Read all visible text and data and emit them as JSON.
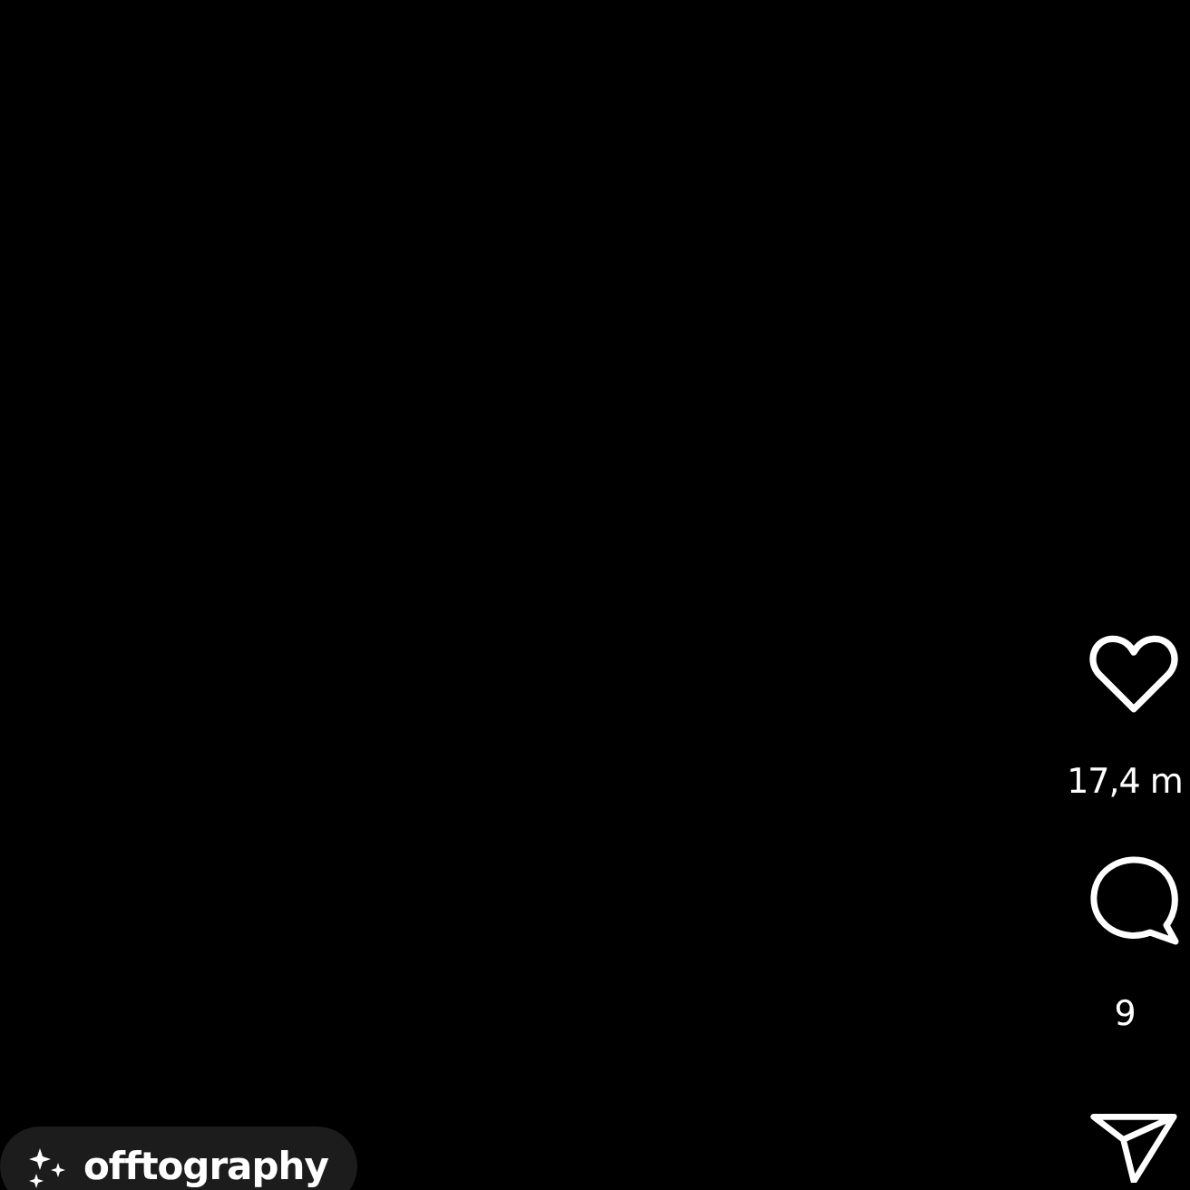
{
  "actions": {
    "likes": "17,4 m",
    "comments": "9"
  },
  "creator": {
    "name": "offtography"
  }
}
